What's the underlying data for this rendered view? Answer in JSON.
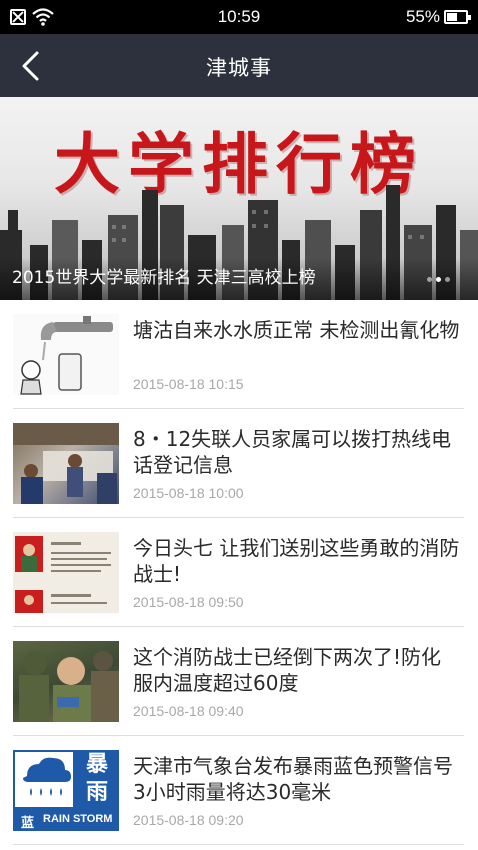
{
  "status_bar": {
    "time": "10:59",
    "battery": "55%"
  },
  "nav": {
    "title": "津城事"
  },
  "banner": {
    "heading": "大学排行榜",
    "caption": "2015世界大学最新排名 天津三高校上榜",
    "dots": 3,
    "active_dot": 1
  },
  "news": [
    {
      "title": "塘沽自来水水质正常 未检测出氰化物",
      "time": "2015-08-18 10:15",
      "thumb_icon": "water-tap-cartoon-icon"
    },
    {
      "title": "8・12失联人员家属可以拨打热线电话登记信息",
      "time": "2015-08-18 10:00",
      "thumb_icon": "people-registration-photo"
    },
    {
      "title": "今日头七 让我们送别这些勇敢的消防战士!",
      "time": "2015-08-18 09:50",
      "thumb_icon": "firefighter-memorial-photo"
    },
    {
      "title": "这个消防战士已经倒下两次了!防化服内温度超过60度",
      "time": "2015-08-18 09:40",
      "thumb_icon": "firefighter-rescue-photo"
    },
    {
      "title": "天津市气象台发布暴雨蓝色预警信号 3小时雨量将达30毫米",
      "time": "2015-08-18 09:20",
      "thumb_icon": "rainstorm-warning-icon",
      "thumb_text": {
        "top": "暴",
        "bottom": "雨",
        "label_cn": "蓝",
        "label_en": "RAIN STORM"
      }
    }
  ],
  "colors": {
    "navbar": "#2d313d",
    "banner_heading": "#c8171b",
    "rainstorm_blue": "#1e5aa8",
    "time_text": "#a8a8a8"
  }
}
